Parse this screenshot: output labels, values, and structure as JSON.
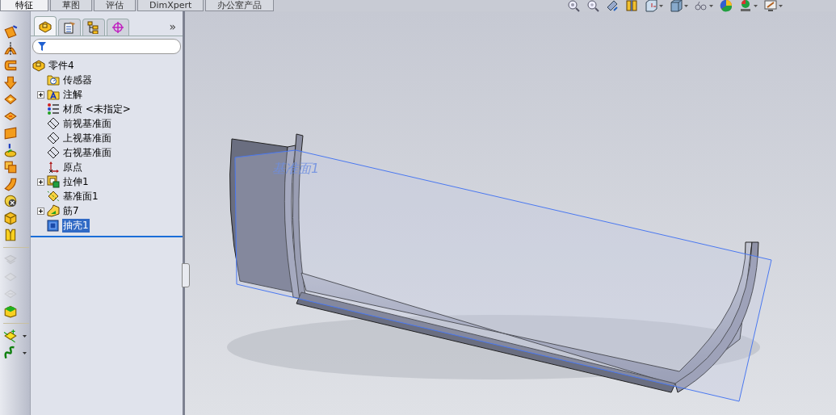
{
  "command_tabs": [
    {
      "label": "特征",
      "selected": true
    },
    {
      "label": "草图",
      "selected": false
    },
    {
      "label": "评估",
      "selected": false
    },
    {
      "label": "DimXpert",
      "selected": false
    },
    {
      "label": "办公室产品",
      "selected": false
    }
  ],
  "left_toolbar": [
    {
      "kind": "tool",
      "disabled": false
    },
    {
      "kind": "tool",
      "disabled": false
    },
    {
      "kind": "tool",
      "disabled": false
    },
    {
      "kind": "tool",
      "disabled": false
    },
    {
      "kind": "tool",
      "disabled": false
    },
    {
      "kind": "tool",
      "disabled": false
    },
    {
      "kind": "tool",
      "disabled": false
    },
    {
      "kind": "tool",
      "disabled": false
    },
    {
      "kind": "tool",
      "disabled": false
    },
    {
      "kind": "tool",
      "disabled": false
    },
    {
      "kind": "tool",
      "disabled": false
    },
    {
      "kind": "tool",
      "disabled": false
    },
    {
      "kind": "tool",
      "disabled": false
    },
    {
      "kind": "separator"
    },
    {
      "kind": "tool",
      "disabled": true
    },
    {
      "kind": "tool",
      "disabled": true
    },
    {
      "kind": "tool",
      "disabled": true
    },
    {
      "kind": "tool",
      "disabled": false
    },
    {
      "kind": "separator"
    },
    {
      "kind": "flyout",
      "disabled": false
    },
    {
      "kind": "flyout",
      "disabled": false
    }
  ],
  "panel_tabs": [
    {
      "selected": true
    },
    {
      "selected": false
    },
    {
      "selected": false
    },
    {
      "selected": false
    }
  ],
  "panel_more": "»",
  "tree": {
    "label": "零件4",
    "children": [
      {
        "label": "传感器",
        "kind": "sensor",
        "selected": false
      },
      {
        "label": "注解",
        "kind": "annotation",
        "expanded": false,
        "selected": false
      },
      {
        "label": "材质 <未指定>",
        "kind": "material",
        "selected": false
      },
      {
        "label": "前视基准面",
        "kind": "plane",
        "selected": false
      },
      {
        "label": "上视基准面",
        "kind": "plane",
        "selected": false
      },
      {
        "label": "右视基准面",
        "kind": "plane",
        "selected": false
      },
      {
        "label": "原点",
        "kind": "origin",
        "selected": false
      },
      {
        "label": "拉伸1",
        "kind": "extrude",
        "expanded": false,
        "selected": false
      },
      {
        "label": "基准面1",
        "kind": "refplane",
        "selected": false
      },
      {
        "label": "筋7",
        "kind": "rib",
        "expanded": false,
        "selected": false
      },
      {
        "label": "抽壳1",
        "kind": "shell",
        "selected": true
      }
    ]
  },
  "view_toolbar": [
    {
      "dropdown": false
    },
    {
      "dropdown": false
    },
    {
      "dropdown": false
    },
    {
      "dropdown": false
    },
    {
      "dropdown": true
    },
    {
      "dropdown": true
    },
    {
      "dropdown": true
    },
    {
      "dropdown": false
    },
    {
      "dropdown": true
    },
    {
      "dropdown": true
    }
  ],
  "viewport": {
    "plane_label": "基准面1"
  }
}
